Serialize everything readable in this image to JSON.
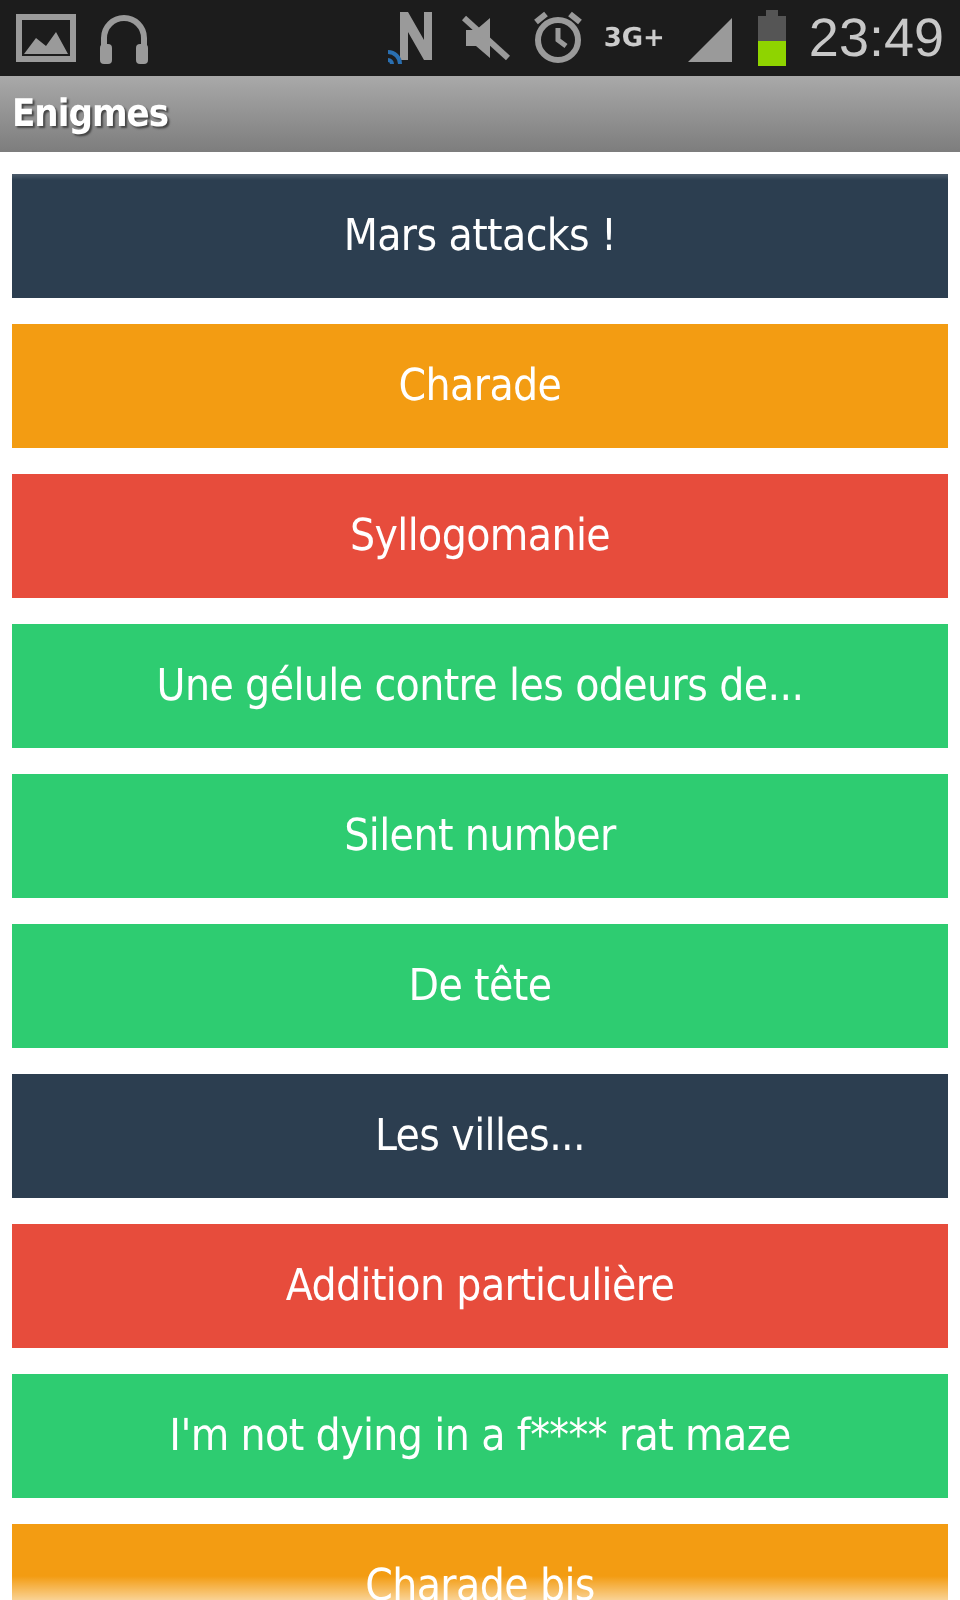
{
  "status_bar": {
    "network": "3G+",
    "time": "23:49"
  },
  "app_bar": {
    "title": "Enigmes"
  },
  "items": [
    {
      "label": "Mars attacks !",
      "color": "#2c3e50"
    },
    {
      "label": "Charade",
      "color": "#f39c12"
    },
    {
      "label": "Syllogomanie",
      "color": "#e74c3c"
    },
    {
      "label": "Une gélule contre les odeurs de...",
      "color": "#2ecc71"
    },
    {
      "label": "Silent number",
      "color": "#2ecc71"
    },
    {
      "label": "De tête",
      "color": "#2ecc71"
    },
    {
      "label": "Les villes...",
      "color": "#2c3e50"
    },
    {
      "label": "Addition particulière",
      "color": "#e74c3c"
    },
    {
      "label": "I'm not dying in a f**** rat maze",
      "color": "#2ecc71"
    },
    {
      "label": "Charade bis",
      "color": "#f39c12"
    }
  ]
}
